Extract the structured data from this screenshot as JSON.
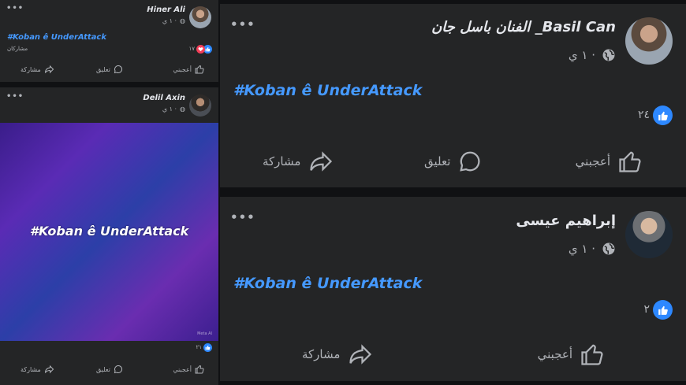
{
  "posts": [
    {
      "author": "Hiner Ali",
      "time": "١ ي ·",
      "hashtag": "#Koban ê UnderAttack",
      "shares": "مشاركان",
      "reaction_count": "١٧",
      "actions": {
        "like": "أعجبني",
        "comment": "تعليق",
        "share": "مشاركة"
      }
    },
    {
      "author": "Delil Axin",
      "time": "١ ي ·",
      "hashtag": "#Koban ê UnderAttack",
      "watermark": "Meta AI",
      "reaction_count": "٢١",
      "actions": {
        "like": "أعجبني",
        "comment": "تعليق",
        "share": "مشاركة"
      }
    },
    {
      "author": "الفنان باسل جان _Basil Can",
      "time": "١ ي ·",
      "hashtag": "#Koban ê UnderAttack",
      "reaction_count": "٢٤",
      "actions": {
        "like": "أعجبني",
        "comment": "تعليق",
        "share": "مشاركة"
      }
    },
    {
      "author": "إبراهيم عيسى",
      "time": "١ ي ·",
      "hashtag": "#Koban ê UnderAttack",
      "reaction_count": "٢",
      "actions": {
        "like": "أعجبني",
        "share": "مشاركة"
      }
    }
  ],
  "colors": {
    "background": "#101113",
    "card": "#242526",
    "hashtag": "#4599ff",
    "like": "#2d88ff",
    "love": "#f33e58"
  },
  "icons": [
    "more-dots-icon",
    "globe-icon",
    "like-icon",
    "heart-icon",
    "thumb-icon",
    "comment-icon",
    "share-icon"
  ]
}
